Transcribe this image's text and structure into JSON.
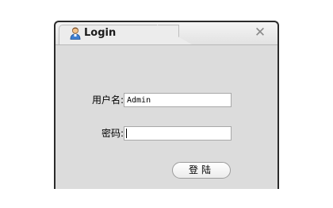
{
  "window": {
    "title": "Login",
    "close_glyph": "✕",
    "title_icon": "user-icon"
  },
  "form": {
    "username_label": "用户名:",
    "username_value": "Admin",
    "password_label": "密码:",
    "password_value": "",
    "submit_label": "登陆"
  },
  "colors": {
    "dialog_background": "#dcdcdc",
    "border": "#2b2b2b",
    "close_icon": "#8a8a8a"
  }
}
